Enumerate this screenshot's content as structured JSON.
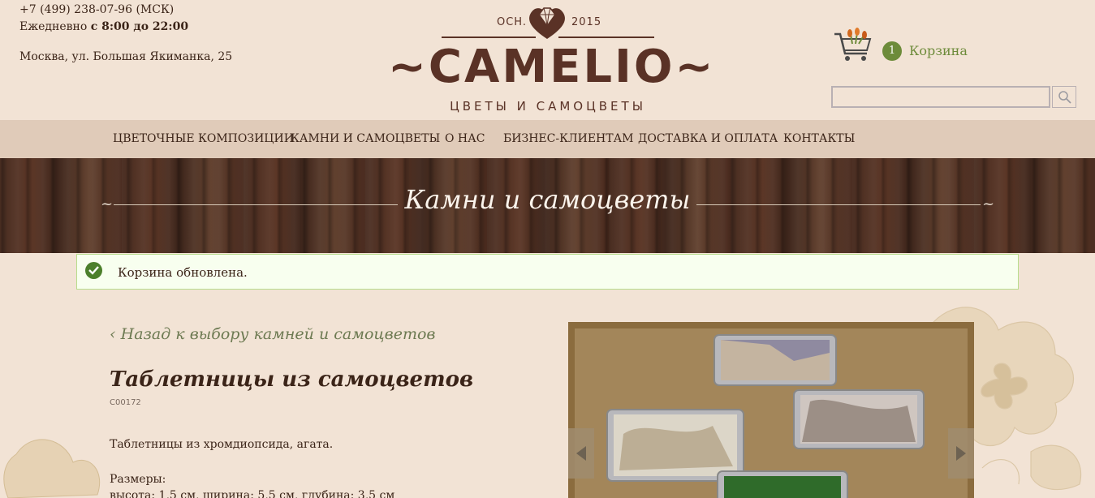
{
  "header": {
    "phone": "+7 (499) 238-07-96 (МСК)",
    "hours_prefix": "Ежедневно ",
    "hours_bold": "с 8:00 до 22:00",
    "address": "Москва, ул. Большая Якиманка, 25"
  },
  "logo": {
    "est_left": "OCH.",
    "est_right": "2015",
    "name": "~CAMELIO~",
    "tagline": "ЦВЕТЫ И САМОЦВЕТЫ"
  },
  "cart": {
    "count": "1",
    "label": "Корзина"
  },
  "search": {
    "placeholder": ""
  },
  "nav": {
    "items": [
      "ЦВЕТОЧНЫЕ КОМПОЗИЦИИ",
      "КАМНИ И САМОЦВЕТЫ",
      "О НАС",
      "БИЗНЕС-КЛИЕНТАМ",
      "ДОСТАВКА И ОПЛАТА",
      "КОНТАКТЫ"
    ]
  },
  "banner": {
    "title": "Камни и самоцветы"
  },
  "notice": {
    "text": "Корзина обновлена."
  },
  "product": {
    "back_link": "‹ Назад к выбору камней и самоцветов",
    "title": "Таблетницы из самоцветов",
    "sku": "C00172",
    "description": "Таблетницы из хромдиопсида, агата.",
    "sizes_label": "Размеры:",
    "sizes_line": "высота: 1,5 см, ширина: 5,5 см, глубина: 3,5 см"
  },
  "colors": {
    "brand_brown": "#5a3226",
    "accent_green": "#6d8b3a",
    "background": "#f2e3d5",
    "nav_bg": "#e0cbb9"
  }
}
